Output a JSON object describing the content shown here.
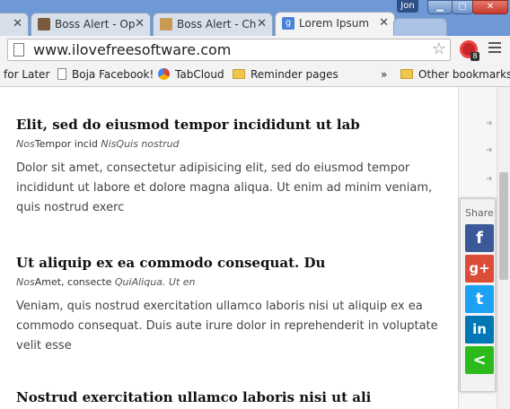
{
  "browser": {
    "tabs": [
      {
        "label": "",
        "favicon": "none",
        "active": false
      },
      {
        "label": "Boss Alert - Op",
        "favicon": "user-icon",
        "active": false
      },
      {
        "label": "Boss Alert - Ch",
        "favicon": "image-icon",
        "active": false
      },
      {
        "label": "Lorem Ipsum",
        "favicon": "google-icon",
        "active": true
      }
    ],
    "user": "Jon",
    "address": "www.ilovefreesoftware.com",
    "extension_badge": "8",
    "bookmarks": [
      {
        "label": "for Later",
        "icon": "none"
      },
      {
        "label": "Boja Facebook!",
        "icon": "page-icon"
      },
      {
        "label": "TabCloud",
        "icon": "tabcloud-icon"
      },
      {
        "label": "Reminder pages",
        "icon": "folder-icon"
      }
    ],
    "overflow": "»",
    "other_bookmarks": "Other bookmarks"
  },
  "posts": [
    {
      "title": "Elit, sed do eiusmod tempor incididunt ut lab",
      "meta_author": "Nos",
      "meta_text": "Tempor incid ",
      "meta_tags": "NisQuis nostrud",
      "body": "Dolor sit amet, consectetur adipisicing elit, sed do eiusmod tempor incididunt ut labore et dolore magna aliqua. Ut enim ad minim veniam, quis nostrud exerc"
    },
    {
      "title": "Ut aliquip ex ea commodo consequat. Du",
      "meta_author": "Nos",
      "meta_text": "Amet, consecte ",
      "meta_tags": "QuiAliqua. Ut en",
      "body": "Veniam, quis nostrud exercitation ullamco laboris nisi ut aliquip ex ea commodo consequat. Duis aute irure dolor in reprehenderit in voluptate velit esse"
    },
    {
      "title": "Nostrud exercitation ullamco laboris nisi ut ali"
    }
  ],
  "share": {
    "label": "Share",
    "buttons": [
      {
        "name": "facebook",
        "glyph": "f",
        "color": "#3b5998"
      },
      {
        "name": "google-plus",
        "glyph": "g+",
        "color": "#dd4b39"
      },
      {
        "name": "twitter",
        "glyph": "t",
        "color": "#1da1f2"
      },
      {
        "name": "linkedin",
        "glyph": "in",
        "color": "#0077b5"
      },
      {
        "name": "share",
        "glyph": "<",
        "color": "#2bbc1b"
      }
    ]
  },
  "colors": {
    "titlebar": "#6e98d6",
    "toolbar": "#f3f3f3"
  }
}
